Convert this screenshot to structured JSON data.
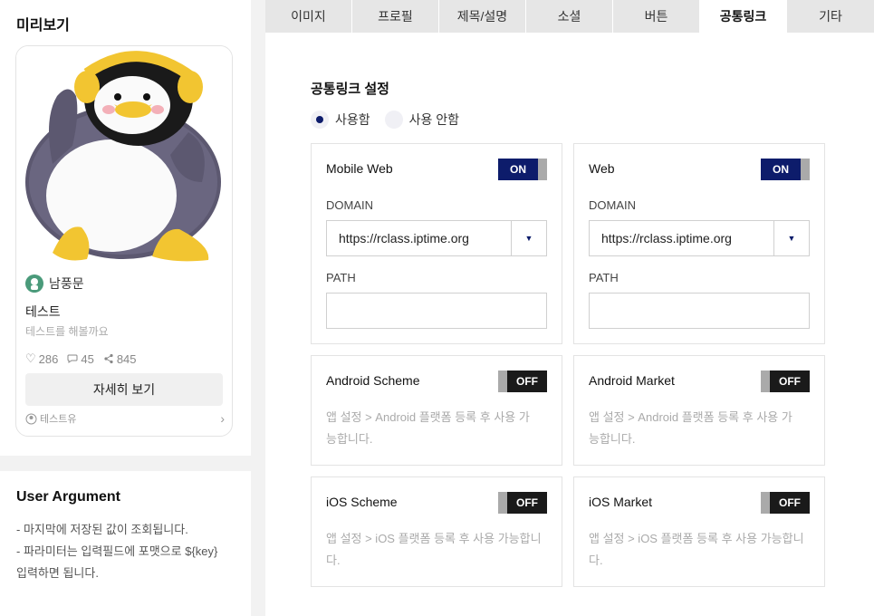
{
  "preview": {
    "title": "미리보기",
    "author": "남풍문",
    "name": "테스트",
    "description": "테스트를 해볼까요",
    "likes": "286",
    "comments": "45",
    "shares": "845",
    "detail_button": "자세히 보기",
    "footer": "테스트유",
    "avatar_badge": "°°°°"
  },
  "user_argument": {
    "title": "User Argument",
    "line1": "- 마지막에 저장된 값이 조회됩니다.",
    "line2": "- 파라미터는 입력필드에 포맷으로 ${key}",
    "line3": "입력하면 됩니다."
  },
  "tabs": [
    {
      "label": "이미지"
    },
    {
      "label": "프로필"
    },
    {
      "label": "제목/설명"
    },
    {
      "label": "소셜"
    },
    {
      "label": "버튼"
    },
    {
      "label": "공통링크"
    },
    {
      "label": "기타"
    }
  ],
  "common_link": {
    "title": "공통링크 설정",
    "radio_use": "사용함",
    "radio_not_use": "사용 안함",
    "mobile_web": {
      "label": "Mobile Web",
      "toggle": "ON",
      "domain_label": "DOMAIN",
      "domain_value": "https://rclass.iptime.org",
      "path_label": "PATH",
      "path_value": ""
    },
    "web": {
      "label": "Web",
      "toggle": "ON",
      "domain_label": "DOMAIN",
      "domain_value": "https://rclass.iptime.org",
      "path_label": "PATH",
      "path_value": ""
    },
    "android_scheme": {
      "label": "Android Scheme",
      "toggle": "OFF",
      "hint_line1": "앱 설정 > Android 플랫폼 등록 후 사용 가",
      "hint_line2": "능합니다."
    },
    "android_market": {
      "label": "Android Market",
      "toggle": "OFF",
      "hint_line1": "앱 설정 > Android 플랫폼 등록 후 사용 가",
      "hint_line2": "능합니다."
    },
    "ios_scheme": {
      "label": "iOS Scheme",
      "toggle": "OFF",
      "hint_line1": "앱 설정 > iOS 플랫폼 등록 후 사용 가능합니",
      "hint_line2": "다."
    },
    "ios_market": {
      "label": "iOS Market",
      "toggle": "OFF",
      "hint_line1": "앱 설정 > iOS 플랫폼 등록 후 사용 가능합니",
      "hint_line2": "다."
    }
  },
  "colors": {
    "accent": "#0d1c6b",
    "toggle_off": "#1a1a1a",
    "tab_bg": "#e6e6e6"
  }
}
